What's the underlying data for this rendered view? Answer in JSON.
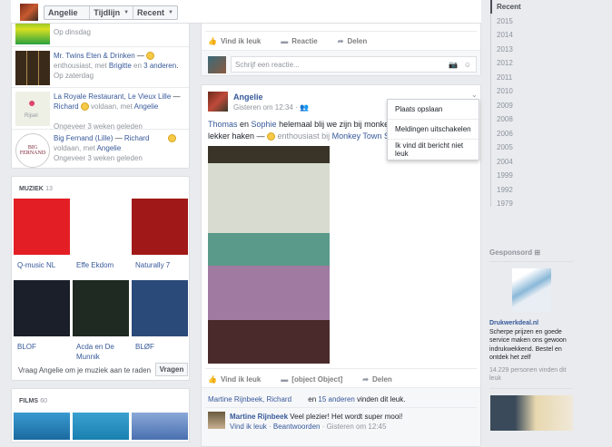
{
  "header": {
    "profile_name": "Angelie",
    "timeline_label": "Tijdlijn",
    "sort_label": "Recent"
  },
  "places": [
    {
      "time": "Op dinsdag"
    },
    {
      "title": "Mr. Twins Eten & Drinken",
      "sep": " — ",
      "feeling": "enthousiast, met ",
      "with": "Brigitte",
      "and": " en ",
      "others": "3 anderen",
      "end": ".",
      "time": "Op zaterdag"
    },
    {
      "title": "La Royale Restaurant, Le Vieux Lille",
      "sep": " — ",
      "person": "Richard",
      "feeling": " voldaan, met ",
      "with": "Angelie",
      "time": "Ongeveer 3 weken geleden",
      "map_label": "Rijsel"
    },
    {
      "title": "Big Fernand (Lille)",
      "sep": " — ",
      "person": "Richard",
      "feeling": "voldaan, met ",
      "with": "Angelie",
      "time": "Ongeveer 3 weken geleden",
      "logo_text": "BIG FERNAND"
    }
  ],
  "music": {
    "title": "MUZIEK",
    "count": "13",
    "items": [
      {
        "name": "Q-music NL",
        "color": "#e31e24"
      },
      {
        "name": "Effe Ekdom",
        "color": "#ffffff"
      },
      {
        "name": "Naturally 7",
        "color": "#a01818"
      },
      {
        "name": "BLOF",
        "color": "#1a1f2a"
      },
      {
        "name": "Acda en De Munnik",
        "color": "#1e2a22"
      },
      {
        "name": "BLØF",
        "color": "#2a4a7a"
      }
    ],
    "ask_text": "Vraag Angelie om je muziek aan te raden",
    "ask_button": "Vragen"
  },
  "films": {
    "title": "FILMS",
    "count": "60"
  },
  "prev_post": {
    "like": "Vind ik leuk",
    "comment": "Reactie",
    "share": "Delen",
    "comment_placeholder": "Schrijf een reactie..."
  },
  "post": {
    "author": "Angelie",
    "time": "Gisteren om 12:34",
    "separator": "·",
    "text_p1": "Thomas",
    "text_en": " en ",
    "text_p2": "Sophie",
    "text_rest": " helemaal blij we zijn bij monkey t",
    "text_line2": "lekker haken — ",
    "feeling": " enthousiast bij ",
    "place": "Monkey Town Sp",
    "like": "Vind ik leuk",
    "comment": {
      "author": "Martine Rijnbeek",
      "text": " Veel plezier! Het wordt super mooi!",
      "like": "Vind ik leuk",
      "dot": " · ",
      "reply": "Beantwoorden",
      "time": " · Gisteren om 12:45"
    },
    "share": "Delen",
    "likers": "Martine Rijnbeek, Richard",
    "likers_and": " en ",
    "likers_others": "15 anderen",
    "likers_end": " vinden dit leuk."
  },
  "post_menu": [
    "Plaats opslaan",
    "Meldingen uitschakelen",
    "Ik vind dit bericht niet leuk"
  ],
  "timeline_years": [
    "Recent",
    "2015",
    "2014",
    "2013",
    "2012",
    "2011",
    "2010",
    "2009",
    "2008",
    "2006",
    "2005",
    "2004",
    "1999",
    "1992",
    "1979"
  ],
  "sponsored": {
    "title": "Gesponsord",
    "advertiser": "Drukwerkdeal.nl",
    "body": "Scherpe prijzen en goede service maken ons gewoon indrukwekkend. Bestel en ontdek het zelf",
    "likes": "14.229 personen vinden dit leuk"
  }
}
